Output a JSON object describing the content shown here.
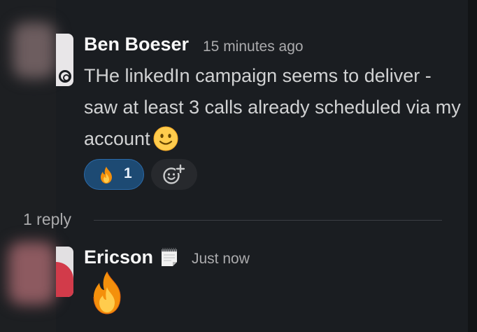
{
  "messages": [
    {
      "author": "Ben Boeser",
      "timestamp": "15 minutes ago",
      "text": "THe linkedIn campaign seems to deliver - saw at least 3 calls already scheduled via my account",
      "trailing_emoji": "slightly-smiling-face",
      "reactions": [
        {
          "emoji": "fire",
          "count": "1"
        }
      ],
      "add_reaction_icon": "add-emoji-icon"
    },
    {
      "author": "Ericson",
      "status_emoji": "spiral-notepad",
      "timestamp": "Just now",
      "content_emoji": "fire"
    }
  ],
  "thread": {
    "replies_label": "1 reply"
  },
  "colors": {
    "background": "#1a1d21",
    "reaction_active_bg": "#1d4a73",
    "reaction_active_border": "#2b6aa8",
    "text_primary": "#f8f8f8",
    "text_body": "#d1d2d3",
    "text_muted": "#ababad"
  }
}
